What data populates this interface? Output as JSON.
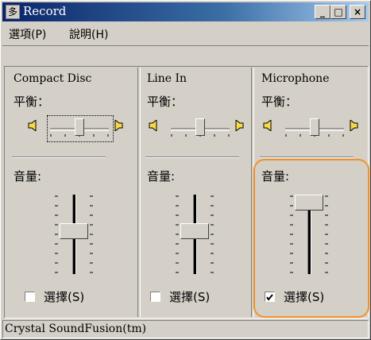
{
  "window": {
    "title": "Record",
    "app_icon_glyph": "多",
    "controls": {
      "minimize": "_",
      "maximize": "□",
      "close": "×"
    }
  },
  "menu": [
    "選項(P)",
    "說明(H)"
  ],
  "channels": [
    {
      "name": "Compact Disc",
      "balance_label": "平衡：",
      "volume_label": "音量:",
      "select_label": "選擇(S)",
      "selected": false,
      "balance": 0.5,
      "volume": 0.6
    },
    {
      "name": "Line In",
      "balance_label": "平衡：",
      "volume_label": "音量:",
      "select_label": "選擇(S)",
      "selected": false,
      "balance": 0.5,
      "volume": 0.6
    },
    {
      "name": "Microphone",
      "balance_label": "平衡：",
      "volume_label": "音量:",
      "select_label": "選擇(S)",
      "selected": true,
      "balance": 0.5,
      "volume": 1.0
    }
  ],
  "status": "Crystal SoundFusion(tm)",
  "colors": {
    "highlight": "#f0922a",
    "titlebar_start": "#0a246a",
    "titlebar_end": "#a6caf0"
  }
}
